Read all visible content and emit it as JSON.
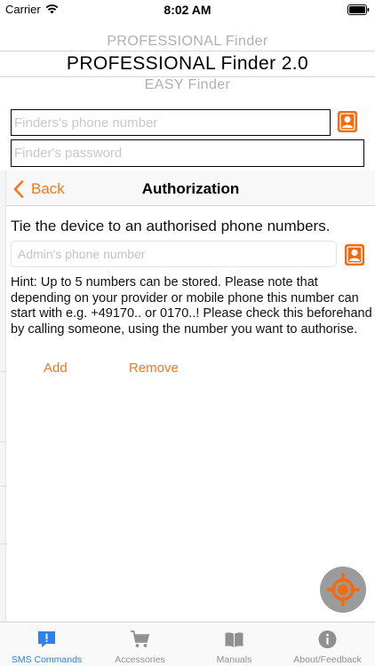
{
  "status_bar": {
    "carrier": "Carrier",
    "time": "8:02 AM"
  },
  "picker": {
    "above": "PROFESSIONAL Finder",
    "selected": "PROFESSIONAL Finder 2.0",
    "below": "EASY Finder"
  },
  "background_form": {
    "phone_placeholder": "Finders's phone number",
    "password_placeholder": "Finder's password"
  },
  "modal": {
    "back_label": "Back",
    "title": "Authorization",
    "lead": "Tie the device to an authorised phone numbers.",
    "admin_placeholder": "Admin's phone number",
    "hint": "Hint: Up to 5 numbers can be stored. Please note that depending on your provider or mobile phone this number can start with e.g. +49170.. or 0170..! Please check this beforehand by calling someone, using the number you want to authorise.",
    "add_label": "Add",
    "remove_label": "Remove"
  },
  "tabs": [
    {
      "label": "SMS Commands",
      "icon": "sms-commands-icon",
      "active": true
    },
    {
      "label": "Accessories",
      "icon": "cart-icon",
      "active": false
    },
    {
      "label": "Manuals",
      "icon": "book-icon",
      "active": false
    },
    {
      "label": "About/Feedback",
      "icon": "info-icon",
      "active": false
    }
  ],
  "colors": {
    "accent": "#f07a1a",
    "tab_active": "#2f80ed",
    "tab_inactive": "#909090"
  }
}
